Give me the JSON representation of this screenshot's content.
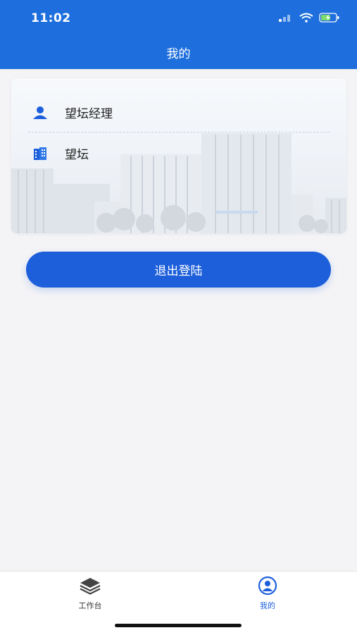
{
  "status_bar": {
    "time": "11:02"
  },
  "header": {
    "title": "我的"
  },
  "profile_card": {
    "name": "望坛经理",
    "organization": "望坛"
  },
  "logout_label": "退出登陆",
  "tabbar": {
    "items": [
      {
        "label": "工作台",
        "icon": "stack-layers-icon",
        "active": false
      },
      {
        "label": "我的",
        "icon": "user-circle-icon",
        "active": true
      }
    ]
  },
  "colors": {
    "brand": "#1e6fdd",
    "button": "#1d5fdb",
    "active_tab": "#1d5fdb"
  }
}
